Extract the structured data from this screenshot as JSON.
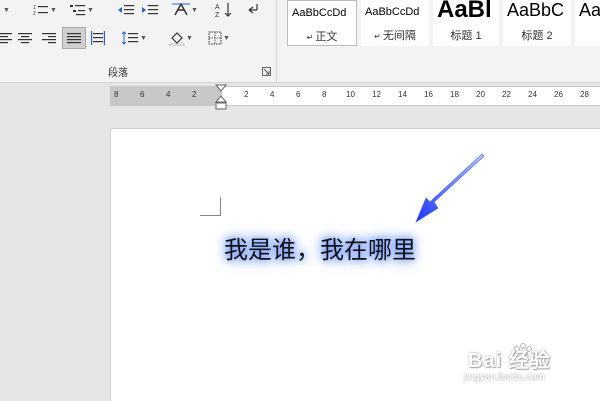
{
  "ribbon": {
    "paragraph_group_label": "段落"
  },
  "styles": [
    {
      "sample": "AaBbCcDd",
      "name": "正文",
      "mark": "↵"
    },
    {
      "sample": "AaBbCcDd",
      "name": "无间隔",
      "mark": "↵"
    },
    {
      "sample": "AaBl",
      "name": "标题 1"
    },
    {
      "sample": "AaBbC",
      "name": "标题 2"
    },
    {
      "sample": "Aa",
      "name": ""
    }
  ],
  "ruler": {
    "left_numbers": [
      "8",
      "6",
      "4",
      "2"
    ],
    "right_numbers": [
      "2",
      "4",
      "6",
      "8",
      "10",
      "12",
      "14",
      "16",
      "18",
      "20",
      "22",
      "24",
      "26",
      "28"
    ]
  },
  "document": {
    "text": "我是谁，我在哪里"
  },
  "annotation": {
    "arrow_color": "#1a33ff",
    "glow_color": "#5a86ff"
  },
  "watermark": {
    "brand": "Bai 经验",
    "url": "jingyan.baidu.com"
  }
}
